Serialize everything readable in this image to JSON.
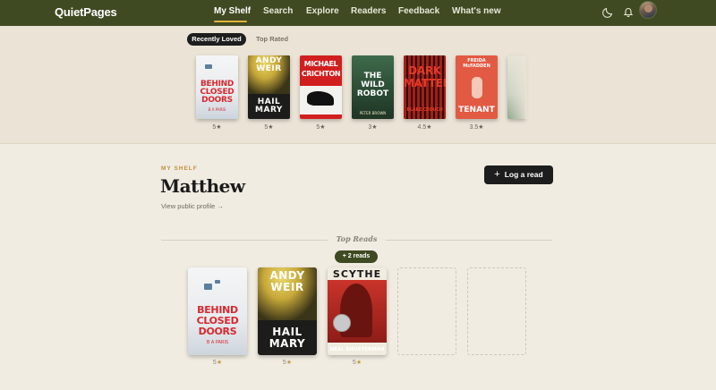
{
  "nav": {
    "logo": "QuietPages",
    "links": [
      "My Shelf",
      "Search",
      "Explore",
      "Readers",
      "Feedback",
      "What's new"
    ],
    "active": "My Shelf"
  },
  "strip": {
    "tabs": [
      "Recently Loved",
      "Top Rated"
    ],
    "active_tab": "Recently Loved",
    "books": [
      {
        "title": "Behind Closed Doors",
        "cover_lines": [
          "BEHIND",
          "CLOSED",
          "DOORS"
        ],
        "author": "B A PARIS",
        "rating": "5★"
      },
      {
        "title": "Project Hail Mary",
        "cover_lines": [
          "ANDY",
          "WEIR",
          "HAIL",
          "MARY"
        ],
        "author": "Andy Weir",
        "rating": "5★"
      },
      {
        "title": "Jurassic Park",
        "cover_lines": [
          "MICHAEL",
          "CRICHTON"
        ],
        "author": "Michael Crichton",
        "rating": "5★"
      },
      {
        "title": "The Wild Robot",
        "cover_lines": [
          "THE",
          "WILD",
          "ROBOT"
        ],
        "author": "PETER BROWN",
        "rating": "3★"
      },
      {
        "title": "Dark Matter",
        "cover_lines": [
          "DARK",
          "MATTER"
        ],
        "author": "BLAKE CROUCH",
        "rating": "4.5★"
      },
      {
        "title": "The Tenant",
        "cover_lines": [
          "FREIDA",
          "McFADDEN",
          "TENANT"
        ],
        "author": "Freida McFadden",
        "rating": "3.5★"
      }
    ]
  },
  "profile": {
    "section_label": "MY SHELF",
    "name": "Matthew",
    "profile_link": "View public profile →",
    "log_button": "Log a read",
    "log_button_icon": "plus-icon"
  },
  "top_reads": {
    "heading": "Top Reads",
    "badge": "+ 2 reads",
    "books": [
      {
        "title": "Behind Closed Doors",
        "rating": "5"
      },
      {
        "title": "Project Hail Mary",
        "rating": "5"
      },
      {
        "title": "Scythe",
        "cover_title": "SCYTHE",
        "author": "NEAL SHUSTERMAN",
        "rating": "5"
      }
    ],
    "empty_slots": 2
  },
  "icons": {
    "theme": "moon-icon",
    "notifications": "bell-icon"
  },
  "colors": {
    "nav_bg": "#3f4a22",
    "accent": "#e2b23a",
    "page_bg": "#f1ece2"
  }
}
